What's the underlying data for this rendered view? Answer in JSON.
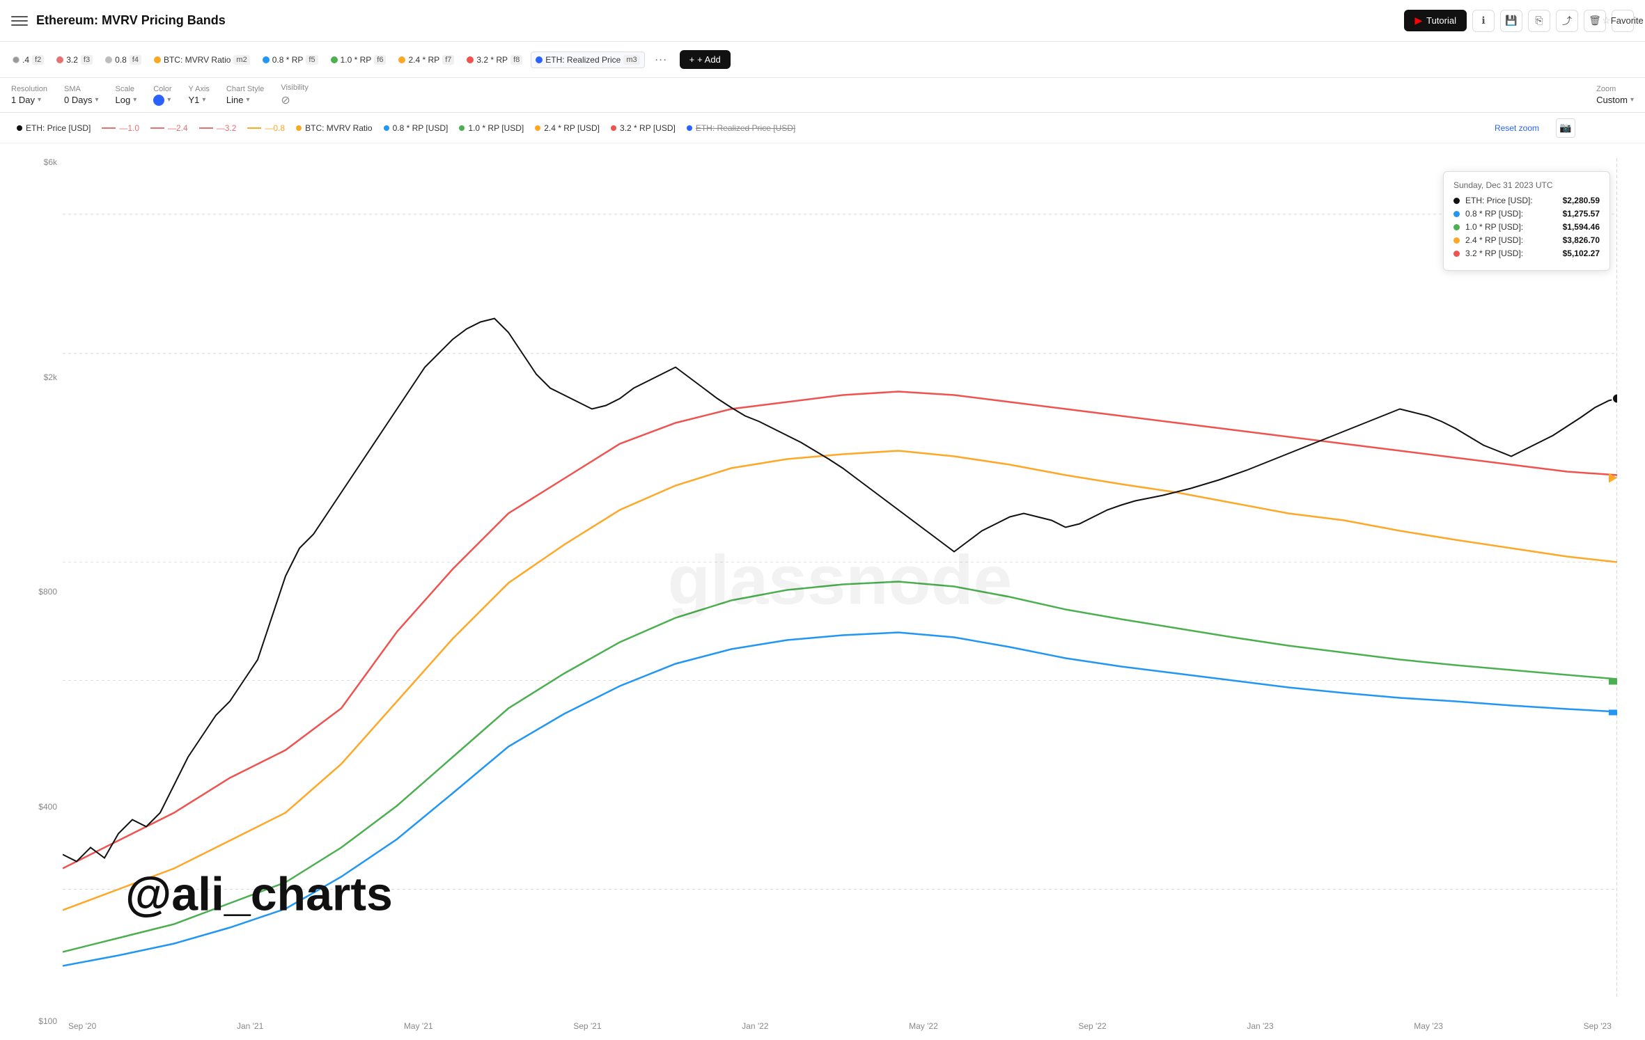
{
  "topbar": {
    "menu_icon": "☰",
    "title": "Ethereum: MVRV Pricing Bands",
    "tutorial_label": "Tutorial",
    "favorite_label": "Favorite"
  },
  "series": [
    {
      "id": "f1",
      "label": ".4",
      "badge": "f2",
      "dot_color": "#999",
      "dot_border": true
    },
    {
      "id": "s2",
      "label": "3.2",
      "badge": "f3",
      "dot_color": "#e57373"
    },
    {
      "id": "s3",
      "label": "0.8",
      "badge": "f4",
      "dot_color": "#bdbdbd"
    },
    {
      "id": "s4",
      "label": "BTC: MVRV Ratio",
      "badge": "m2",
      "dot_color": "#f9a825"
    },
    {
      "id": "s5",
      "label": "0.8 * RP",
      "badge": "f5",
      "dot_color": "#2196f3"
    },
    {
      "id": "s6",
      "label": "1.0 * RP",
      "badge": "f6",
      "dot_color": "#4caf50"
    },
    {
      "id": "s7",
      "label": "2.4 * RP",
      "badge": "f7",
      "dot_color": "#ffa726"
    },
    {
      "id": "s8",
      "label": "3.2 * RP",
      "badge": "f8",
      "dot_color": "#ef5350"
    },
    {
      "id": "s9",
      "label": "ETH: Realized Price",
      "badge": "m3",
      "dot_color": "#2962ff"
    }
  ],
  "add_button": "+ Add",
  "controls": {
    "resolution": {
      "label": "Resolution",
      "value": "1 Day"
    },
    "sma": {
      "label": "SMA",
      "value": "0 Days"
    },
    "scale": {
      "label": "Scale",
      "value": "Log"
    },
    "color": {
      "label": "Color",
      "value": "",
      "swatch": "#2962ff"
    },
    "y_axis": {
      "label": "Y Axis",
      "value": "Y1"
    },
    "chart_style": {
      "label": "Chart Style",
      "value": "Line"
    },
    "visibility": {
      "label": "Visibility",
      "value": "👁"
    },
    "zoom": {
      "label": "Zoom",
      "value": "Custom"
    }
  },
  "legend": [
    {
      "label": "ETH: Price [USD]",
      "type": "dot",
      "color": "#111"
    },
    {
      "label": "—1.0",
      "type": "dash",
      "color": "#e57373"
    },
    {
      "label": "—2.4",
      "type": "dash",
      "color": "#e57373"
    },
    {
      "label": "—3.2",
      "type": "dash",
      "color": "#e57373"
    },
    {
      "label": "—0.8",
      "type": "dash",
      "color": "#ffa726"
    },
    {
      "label": "BTC: MVRV Ratio",
      "type": "dot",
      "color": "#f9a825"
    },
    {
      "label": "0.8 * RP [USD]",
      "type": "dot",
      "color": "#2196f3"
    },
    {
      "label": "1.0 * RP [USD]",
      "type": "dot",
      "color": "#4caf50"
    },
    {
      "label": "2.4 * RP [USD]",
      "type": "dot",
      "color": "#ffa726"
    },
    {
      "label": "3.2 * RP [USD]",
      "type": "dot",
      "color": "#ef5350"
    },
    {
      "label": "ETH: Realized Price [USD]",
      "type": "dot",
      "color": "#2962ff"
    }
  ],
  "reset_zoom": "Reset zoom",
  "chart": {
    "y_labels": [
      "$6k",
      "$2k",
      "$800",
      "$400",
      "$100"
    ],
    "x_labels": [
      "Sep '20",
      "Jan '21",
      "May '21",
      "Sep '21",
      "Jan '22",
      "May '22",
      "Sep '22",
      "Jan '23",
      "May '23",
      "Sep '23"
    ],
    "watermark": "glassnode",
    "attribution": "@ali_charts"
  },
  "tooltip": {
    "title": "Sunday, Dec 31 2023 UTC",
    "rows": [
      {
        "label": "ETH: Price [USD]:",
        "value": "$2,280.59",
        "color": "#111"
      },
      {
        "label": "0.8 * RP [USD]:",
        "value": "$1,275.57",
        "color": "#2196f3"
      },
      {
        "label": "1.0 * RP [USD]:",
        "value": "$1,594.46",
        "color": "#4caf50"
      },
      {
        "label": "2.4 * RP [USD]:",
        "value": "$3,826.70",
        "color": "#ffa726"
      },
      {
        "label": "3.2 * RP [USD]:",
        "value": "$5,102.27",
        "color": "#ef5350"
      }
    ]
  }
}
